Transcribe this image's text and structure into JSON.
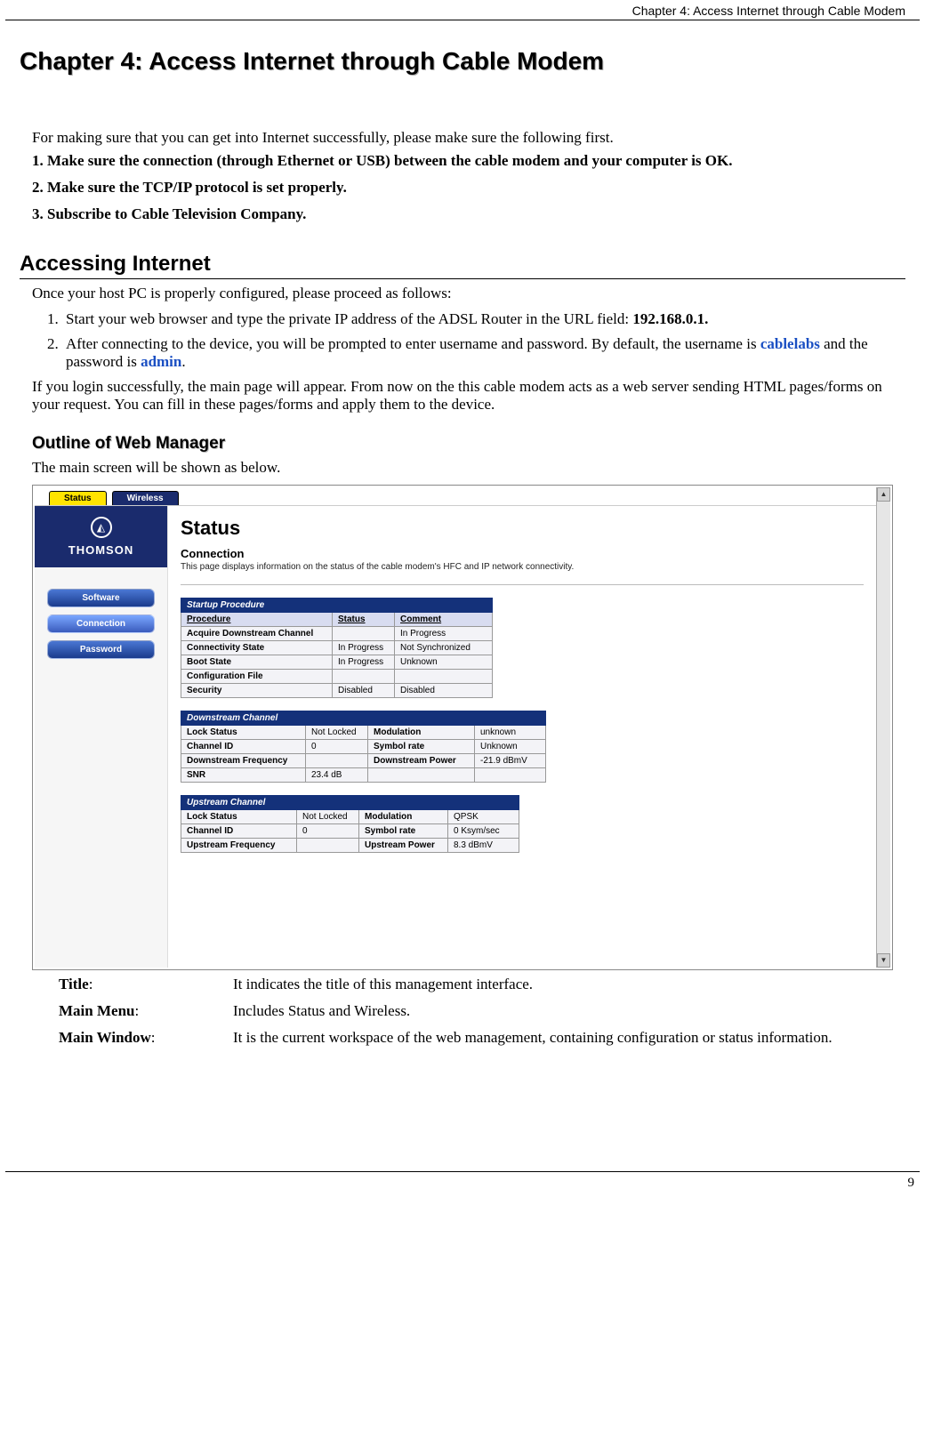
{
  "header_running": "Chapter 4: Access Internet through Cable Modem",
  "chapter_title": "Chapter 4: Access Internet through Cable Modem",
  "intro": "For making sure that you can get into Internet successfully, please make sure the following first.",
  "checklist": [
    "1. Make sure the connection (through Ethernet or USB) between the cable modem and your computer is OK.",
    "2. Make sure the TCP/IP protocol is set properly.",
    "3. Subscribe to Cable Television Company."
  ],
  "section_heading": "Accessing Internet",
  "section_para": "Once your host PC is properly configured, please proceed as follows:",
  "step1_pre": "Start your web browser and type the private IP address of the ADSL Router in the URL field: ",
  "step1_ip": "192.168.0.1.",
  "step2_pre": "After connecting to the device, you will be prompted to enter username and password. By default, the username is ",
  "step2_user": "cablelabs",
  "step2_mid": " and the password is ",
  "step2_pass": "admin",
  "step2_post": ".",
  "login_para": "If you login successfully, the main page will appear. From now on the this cable modem acts as a web server sending HTML pages/forms on your request. You can fill in these pages/forms and apply them to the device.",
  "sub_heading": "Outline of Web Manager",
  "sub_para": "The main screen will be shown as below.",
  "screenshot": {
    "tabs": {
      "active": "Status",
      "inactive": "Wireless"
    },
    "logo": "THOMSON",
    "sidebar": [
      "Software",
      "Connection",
      "Password"
    ],
    "page_title": "Status",
    "page_sub": "Connection",
    "page_desc": "This page displays information on the status of the cable modem's HFC and IP network connectivity.",
    "startup": {
      "title": "Startup Procedure",
      "cols": [
        "Procedure",
        "Status",
        "Comment"
      ],
      "rows": [
        [
          "Acquire Downstream Channel",
          "",
          "In Progress"
        ],
        [
          "Connectivity State",
          "In Progress",
          "Not Synchronized"
        ],
        [
          "Boot State",
          "In Progress",
          "Unknown"
        ],
        [
          "Configuration File",
          "",
          ""
        ],
        [
          "Security",
          "Disabled",
          "Disabled"
        ]
      ]
    },
    "downstream": {
      "title": "Downstream Channel",
      "rows": [
        [
          "Lock Status",
          "Not Locked",
          "Modulation",
          "unknown"
        ],
        [
          "Channel ID",
          "0",
          "Symbol rate",
          "Unknown"
        ],
        [
          "Downstream Frequency",
          "",
          "Downstream Power",
          "-21.9 dBmV"
        ],
        [
          "SNR",
          "23.4 dB",
          "",
          ""
        ]
      ]
    },
    "upstream": {
      "title": "Upstream Channel",
      "rows": [
        [
          "Lock Status",
          "Not Locked",
          "Modulation",
          "QPSK"
        ],
        [
          "Channel ID",
          "0",
          "Symbol rate",
          "0 Ksym/sec"
        ],
        [
          "Upstream Frequency",
          "",
          "Upstream Power",
          "8.3 dBmV"
        ]
      ]
    }
  },
  "definitions": [
    {
      "term": "Title",
      "desc": "It indicates the title of this management interface."
    },
    {
      "term": "Main Menu",
      "desc": "Includes Status and Wireless."
    },
    {
      "term": "Main Window",
      "desc": "It is the current workspace of the web management, containing configuration or status information."
    }
  ],
  "page_number": "9"
}
